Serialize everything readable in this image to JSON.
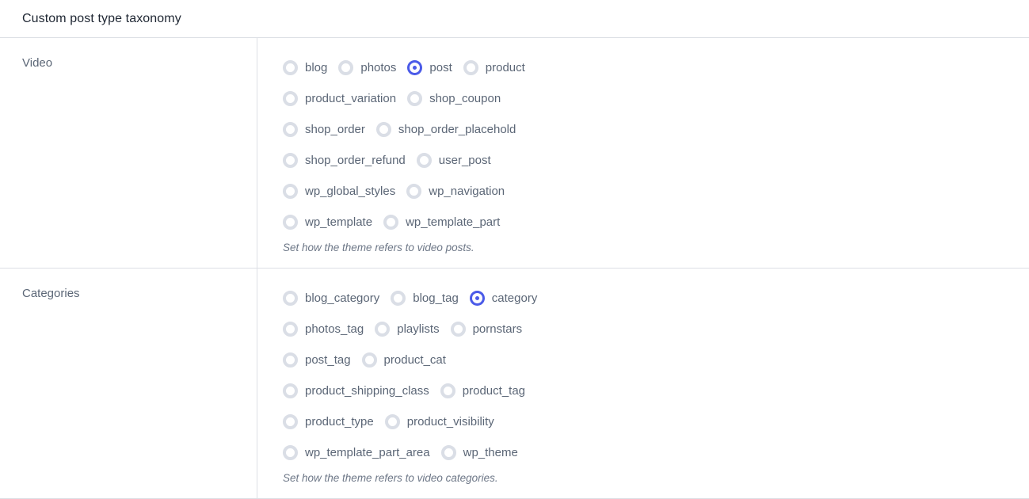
{
  "header": {
    "title": "Custom post type taxonomy"
  },
  "colors": {
    "accent": "#4a5ae8",
    "radio_border": "#dadee6",
    "divider": "#dcdfe5",
    "label_text": "#5b6676",
    "title_text": "#1f2733",
    "help_text": "#6d7787"
  },
  "rows": [
    {
      "label": "Video",
      "help": "Set how the theme refers to video posts.",
      "options": [
        {
          "value": "blog",
          "checked": false
        },
        {
          "value": "photos",
          "checked": false
        },
        {
          "value": "post",
          "checked": true
        },
        {
          "value": "product",
          "checked": false
        },
        {
          "value": "product_variation",
          "checked": false
        },
        {
          "value": "shop_coupon",
          "checked": false
        },
        {
          "value": "shop_order",
          "checked": false
        },
        {
          "value": "shop_order_placehold",
          "checked": false
        },
        {
          "value": "shop_order_refund",
          "checked": false
        },
        {
          "value": "user_post",
          "checked": false
        },
        {
          "value": "wp_global_styles",
          "checked": false
        },
        {
          "value": "wp_navigation",
          "checked": false
        },
        {
          "value": "wp_template",
          "checked": false
        },
        {
          "value": "wp_template_part",
          "checked": false
        }
      ]
    },
    {
      "label": "Categories",
      "help": "Set how the theme refers to video categories.",
      "options": [
        {
          "value": "blog_category",
          "checked": false
        },
        {
          "value": "blog_tag",
          "checked": false
        },
        {
          "value": "category",
          "checked": true
        },
        {
          "value": "photos_tag",
          "checked": false
        },
        {
          "value": "playlists",
          "checked": false
        },
        {
          "value": "pornstars",
          "checked": false
        },
        {
          "value": "post_tag",
          "checked": false
        },
        {
          "value": "product_cat",
          "checked": false
        },
        {
          "value": "product_shipping_class",
          "checked": false
        },
        {
          "value": "product_tag",
          "checked": false
        },
        {
          "value": "product_type",
          "checked": false
        },
        {
          "value": "product_visibility",
          "checked": false
        },
        {
          "value": "wp_template_part_area",
          "checked": false
        },
        {
          "value": "wp_theme",
          "checked": false
        }
      ]
    }
  ]
}
